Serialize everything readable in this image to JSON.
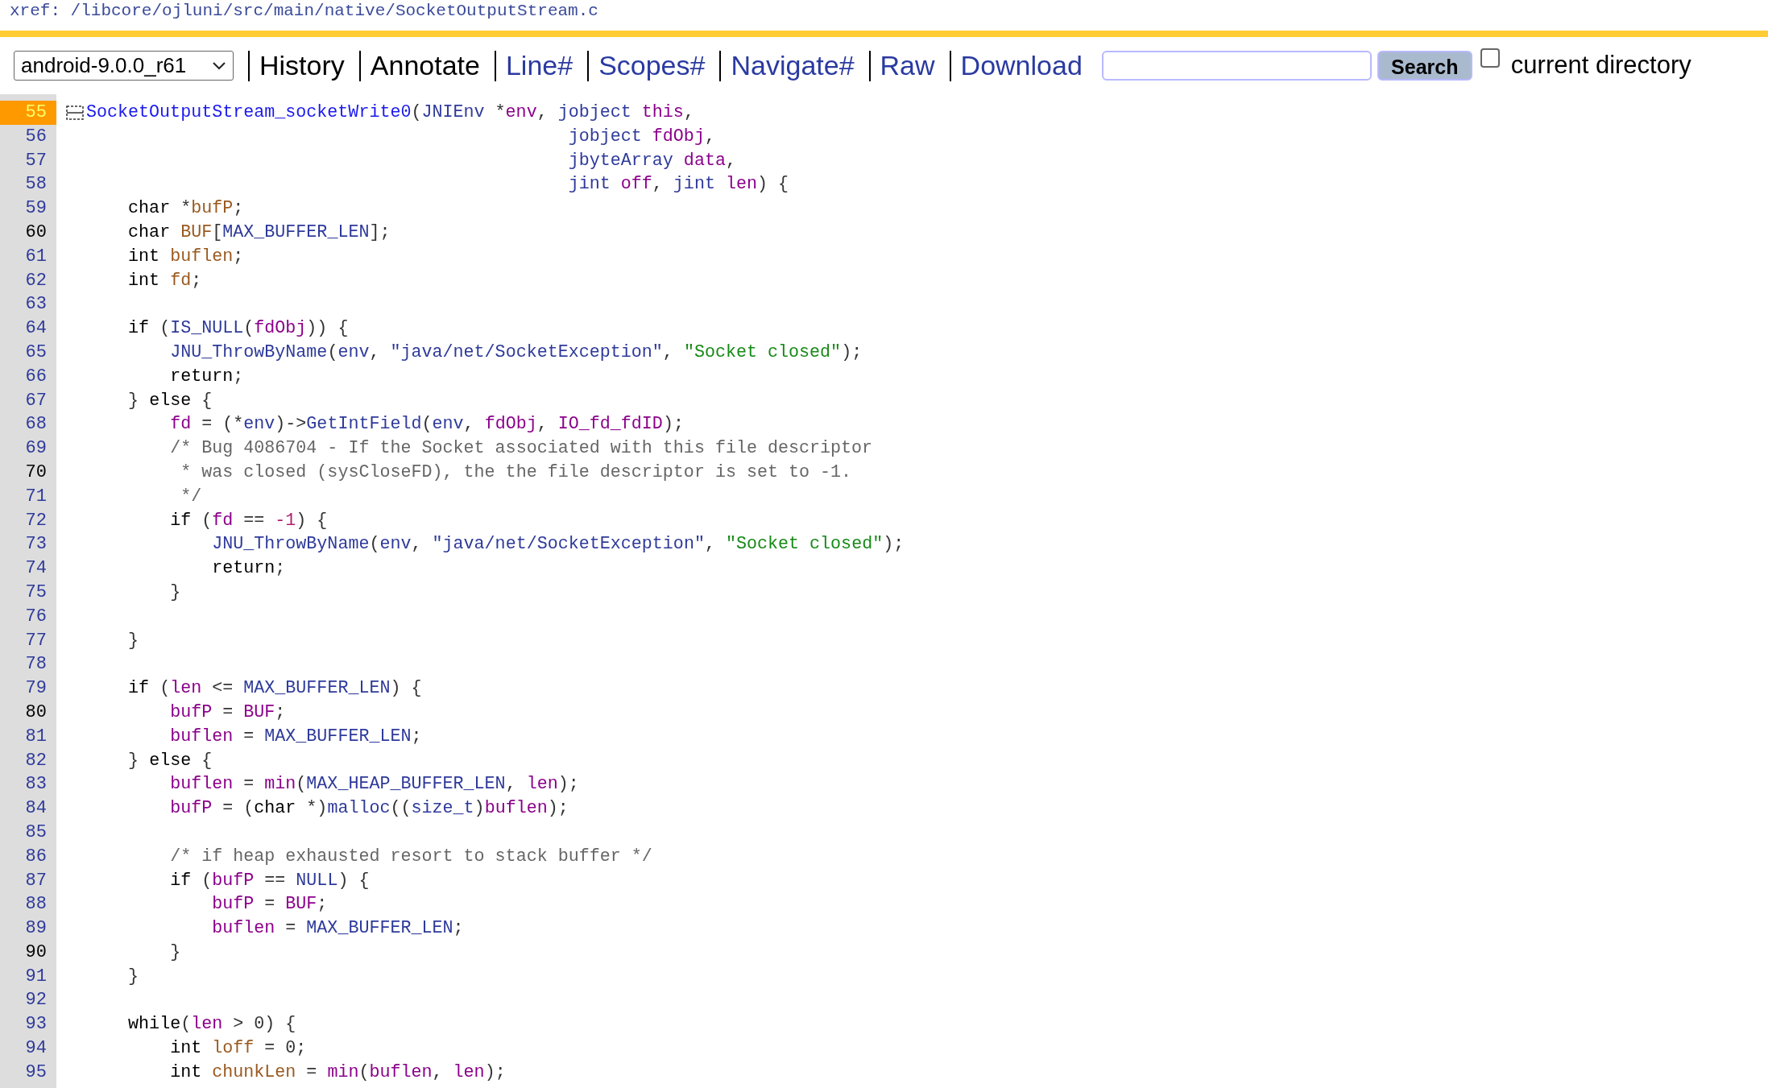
{
  "breadcrumb": "xref: /libcore/ojluni/src/main/native/SocketOutputStream.c",
  "toolbar": {
    "version_select": "android-9.0.0_r61",
    "links": [
      {
        "label": "History",
        "disabled": true
      },
      {
        "label": "Annotate",
        "disabled": true
      },
      {
        "label": "Line#",
        "disabled": false
      },
      {
        "label": "Scopes#",
        "disabled": false
      },
      {
        "label": "Navigate#",
        "disabled": false
      },
      {
        "label": "Raw",
        "disabled": false
      },
      {
        "label": "Download",
        "disabled": false
      }
    ],
    "search_button": "Search",
    "current_directory": {
      "label": "current directory",
      "checked": false
    }
  },
  "lines": [
    {
      "number": "55",
      "selected": true,
      "emphasis": false,
      "foldable": true,
      "tokens": [
        {
          "kind": "def",
          "text": "SocketOutputStream_socketWrite0"
        },
        {
          "kind": "pun",
          "text": "("
        },
        {
          "kind": "ref",
          "text": "JNIEnv"
        },
        {
          "kind": "pun",
          "text": " *"
        },
        {
          "kind": "var",
          "text": "env"
        },
        {
          "kind": "pun",
          "text": ", "
        },
        {
          "kind": "ref",
          "text": "jobject"
        },
        {
          "kind": "var",
          "text": " this"
        },
        {
          "kind": "pun",
          "text": ","
        }
      ]
    },
    {
      "number": "56",
      "selected": false,
      "emphasis": false,
      "foldable": false,
      "tokens": [
        {
          "kind": "ref",
          "text": "                                                jobject"
        },
        {
          "kind": "var",
          "text": " fdObj"
        },
        {
          "kind": "pun",
          "text": ","
        }
      ]
    },
    {
      "number": "57",
      "selected": false,
      "emphasis": false,
      "foldable": false,
      "tokens": [
        {
          "kind": "ref",
          "text": "                                                jbyteArray"
        },
        {
          "kind": "var",
          "text": " data"
        },
        {
          "kind": "pun",
          "text": ","
        }
      ]
    },
    {
      "number": "58",
      "selected": false,
      "emphasis": false,
      "foldable": false,
      "tokens": [
        {
          "kind": "ref",
          "text": "                                                jint"
        },
        {
          "kind": "var",
          "text": " off"
        },
        {
          "kind": "pun",
          "text": ", "
        },
        {
          "kind": "ref",
          "text": "jint"
        },
        {
          "kind": "var",
          "text": " len"
        },
        {
          "kind": "pun",
          "text": ") {"
        }
      ]
    },
    {
      "number": "59",
      "selected": false,
      "emphasis": false,
      "foldable": false,
      "tokens": [
        {
          "kind": "kw",
          "text": "      char"
        },
        {
          "kind": "pun",
          "text": " *"
        },
        {
          "kind": "loc",
          "text": "bufP"
        },
        {
          "kind": "pun",
          "text": ";"
        }
      ]
    },
    {
      "number": "60",
      "selected": false,
      "emphasis": true,
      "foldable": false,
      "tokens": [
        {
          "kind": "kw",
          "text": "      char"
        },
        {
          "kind": "loc",
          "text": " BUF"
        },
        {
          "kind": "pun",
          "text": "["
        },
        {
          "kind": "ref",
          "text": "MAX_BUFFER_LEN"
        },
        {
          "kind": "pun",
          "text": "];"
        }
      ]
    },
    {
      "number": "61",
      "selected": false,
      "emphasis": false,
      "foldable": false,
      "tokens": [
        {
          "kind": "kw",
          "text": "      int"
        },
        {
          "kind": "loc",
          "text": " buflen"
        },
        {
          "kind": "pun",
          "text": ";"
        }
      ]
    },
    {
      "number": "62",
      "selected": false,
      "emphasis": false,
      "foldable": false,
      "tokens": [
        {
          "kind": "kw",
          "text": "      int"
        },
        {
          "kind": "loc",
          "text": " fd"
        },
        {
          "kind": "pun",
          "text": ";"
        }
      ]
    },
    {
      "number": "63",
      "selected": false,
      "emphasis": false,
      "foldable": false
    },
    {
      "number": "64",
      "selected": false,
      "emphasis": false,
      "foldable": false,
      "tokens": [
        {
          "kind": "kw",
          "text": "      if"
        },
        {
          "kind": "pun",
          "text": " ("
        },
        {
          "kind": "ref",
          "text": "IS_NULL"
        },
        {
          "kind": "pun",
          "text": "("
        },
        {
          "kind": "var",
          "text": "fdObj"
        },
        {
          "kind": "pun",
          "text": ")) {"
        }
      ]
    },
    {
      "number": "65",
      "selected": false,
      "emphasis": false,
      "foldable": false,
      "tokens": [
        {
          "kind": "ref",
          "text": "          JNU_ThrowByName"
        },
        {
          "kind": "pun",
          "text": "("
        },
        {
          "kind": "ref",
          "text": "env"
        },
        {
          "kind": "pun",
          "text": ", "
        },
        {
          "kind": "ref",
          "text": "\"java/net/SocketException\""
        },
        {
          "kind": "pun",
          "text": ", "
        },
        {
          "kind": "str",
          "text": "\"Socket closed\""
        },
        {
          "kind": "pun",
          "text": ");"
        }
      ]
    },
    {
      "number": "66",
      "selected": false,
      "emphasis": false,
      "foldable": false,
      "tokens": [
        {
          "kind": "kw",
          "text": "          return"
        },
        {
          "kind": "pun",
          "text": ";"
        }
      ]
    },
    {
      "number": "67",
      "selected": false,
      "emphasis": false,
      "foldable": false,
      "tokens": [
        {
          "kind": "pun",
          "text": "      } "
        },
        {
          "kind": "kw",
          "text": "else"
        },
        {
          "kind": "pun",
          "text": " {"
        }
      ]
    },
    {
      "number": "68",
      "selected": false,
      "emphasis": false,
      "foldable": false,
      "tokens": [
        {
          "kind": "var",
          "text": "          fd"
        },
        {
          "kind": "pun",
          "text": " = (*"
        },
        {
          "kind": "ref",
          "text": "env"
        },
        {
          "kind": "pun",
          "text": ")->"
        },
        {
          "kind": "ref",
          "text": "GetIntField"
        },
        {
          "kind": "pun",
          "text": "("
        },
        {
          "kind": "ref",
          "text": "env"
        },
        {
          "kind": "pun",
          "text": ", "
        },
        {
          "kind": "var",
          "text": "fdObj"
        },
        {
          "kind": "pun",
          "text": ", "
        },
        {
          "kind": "var",
          "text": "IO_fd_fdID"
        },
        {
          "kind": "pun",
          "text": ");"
        }
      ]
    },
    {
      "number": "69",
      "selected": false,
      "emphasis": false,
      "foldable": false,
      "tokens": [
        {
          "kind": "com",
          "text": "          /* Bug 4086704 - If the Socket associated with this file descriptor"
        }
      ]
    },
    {
      "number": "70",
      "selected": false,
      "emphasis": true,
      "foldable": false,
      "tokens": [
        {
          "kind": "com",
          "text": "           * was closed (sysCloseFD), the the file descriptor is set to -1."
        }
      ]
    },
    {
      "number": "71",
      "selected": false,
      "emphasis": false,
      "foldable": false,
      "tokens": [
        {
          "kind": "com",
          "text": "           */"
        }
      ]
    },
    {
      "number": "72",
      "selected": false,
      "emphasis": false,
      "foldable": false,
      "tokens": [
        {
          "kind": "kw",
          "text": "          if"
        },
        {
          "kind": "pun",
          "text": " ("
        },
        {
          "kind": "var",
          "text": "fd"
        },
        {
          "kind": "pun",
          "text": " == "
        },
        {
          "kind": "num",
          "text": "-1"
        },
        {
          "kind": "pun",
          "text": ") {"
        }
      ]
    },
    {
      "number": "73",
      "selected": false,
      "emphasis": false,
      "foldable": false,
      "tokens": [
        {
          "kind": "ref",
          "text": "              JNU_ThrowByName"
        },
        {
          "kind": "pun",
          "text": "("
        },
        {
          "kind": "ref",
          "text": "env"
        },
        {
          "kind": "pun",
          "text": ", "
        },
        {
          "kind": "ref",
          "text": "\"java/net/SocketException\""
        },
        {
          "kind": "pun",
          "text": ", "
        },
        {
          "kind": "str",
          "text": "\"Socket closed\""
        },
        {
          "kind": "pun",
          "text": ");"
        }
      ]
    },
    {
      "number": "74",
      "selected": false,
      "emphasis": false,
      "foldable": false,
      "tokens": [
        {
          "kind": "kw",
          "text": "              return"
        },
        {
          "kind": "pun",
          "text": ";"
        }
      ]
    },
    {
      "number": "75",
      "selected": false,
      "emphasis": false,
      "foldable": false,
      "tokens": [
        {
          "kind": "pun",
          "text": "          }"
        }
      ]
    },
    {
      "number": "76",
      "selected": false,
      "emphasis": false,
      "foldable": false
    },
    {
      "number": "77",
      "selected": false,
      "emphasis": false,
      "foldable": false,
      "tokens": [
        {
          "kind": "pun",
          "text": "      }"
        }
      ]
    },
    {
      "number": "78",
      "selected": false,
      "emphasis": false,
      "foldable": false
    },
    {
      "number": "79",
      "selected": false,
      "emphasis": false,
      "foldable": false,
      "tokens": [
        {
          "kind": "kw",
          "text": "      if"
        },
        {
          "kind": "pun",
          "text": " ("
        },
        {
          "kind": "var",
          "text": "len"
        },
        {
          "kind": "pun",
          "text": " <= "
        },
        {
          "kind": "ref",
          "text": "MAX_BUFFER_LEN"
        },
        {
          "kind": "pun",
          "text": ") {"
        }
      ]
    },
    {
      "number": "80",
      "selected": false,
      "emphasis": true,
      "foldable": false,
      "tokens": [
        {
          "kind": "var",
          "text": "          bufP"
        },
        {
          "kind": "pun",
          "text": " = "
        },
        {
          "kind": "var",
          "text": "BUF"
        },
        {
          "kind": "pun",
          "text": ";"
        }
      ]
    },
    {
      "number": "81",
      "selected": false,
      "emphasis": false,
      "foldable": false,
      "tokens": [
        {
          "kind": "var",
          "text": "          buflen"
        },
        {
          "kind": "pun",
          "text": " = "
        },
        {
          "kind": "ref",
          "text": "MAX_BUFFER_LEN"
        },
        {
          "kind": "pun",
          "text": ";"
        }
      ]
    },
    {
      "number": "82",
      "selected": false,
      "emphasis": false,
      "foldable": false,
      "tokens": [
        {
          "kind": "pun",
          "text": "      } "
        },
        {
          "kind": "kw",
          "text": "else"
        },
        {
          "kind": "pun",
          "text": " {"
        }
      ]
    },
    {
      "number": "83",
      "selected": false,
      "emphasis": false,
      "foldable": false,
      "tokens": [
        {
          "kind": "var",
          "text": "          buflen"
        },
        {
          "kind": "pun",
          "text": " = "
        },
        {
          "kind": "var",
          "text": "min"
        },
        {
          "kind": "pun",
          "text": "("
        },
        {
          "kind": "ref",
          "text": "MAX_HEAP_BUFFER_LEN"
        },
        {
          "kind": "pun",
          "text": ", "
        },
        {
          "kind": "var",
          "text": "len"
        },
        {
          "kind": "pun",
          "text": ");"
        }
      ]
    },
    {
      "number": "84",
      "selected": false,
      "emphasis": false,
      "foldable": false,
      "tokens": [
        {
          "kind": "var",
          "text": "          bufP"
        },
        {
          "kind": "pun",
          "text": " = ("
        },
        {
          "kind": "kw",
          "text": "char"
        },
        {
          "kind": "pun",
          "text": " *)"
        },
        {
          "kind": "ref",
          "text": "malloc"
        },
        {
          "kind": "pun",
          "text": "(("
        },
        {
          "kind": "ref",
          "text": "size_t"
        },
        {
          "kind": "pun",
          "text": ")"
        },
        {
          "kind": "var",
          "text": "buflen"
        },
        {
          "kind": "pun",
          "text": ");"
        }
      ]
    },
    {
      "number": "85",
      "selected": false,
      "emphasis": false,
      "foldable": false
    },
    {
      "number": "86",
      "selected": false,
      "emphasis": false,
      "foldable": false,
      "tokens": [
        {
          "kind": "com",
          "text": "          /* if heap exhausted resort to stack buffer */"
        }
      ]
    },
    {
      "number": "87",
      "selected": false,
      "emphasis": false,
      "foldable": false,
      "tokens": [
        {
          "kind": "kw",
          "text": "          if"
        },
        {
          "kind": "pun",
          "text": " ("
        },
        {
          "kind": "var",
          "text": "bufP"
        },
        {
          "kind": "pun",
          "text": " == "
        },
        {
          "kind": "ref",
          "text": "NULL"
        },
        {
          "kind": "pun",
          "text": ") {"
        }
      ]
    },
    {
      "number": "88",
      "selected": false,
      "emphasis": false,
      "foldable": false,
      "tokens": [
        {
          "kind": "var",
          "text": "              bufP"
        },
        {
          "kind": "pun",
          "text": " = "
        },
        {
          "kind": "var",
          "text": "BUF"
        },
        {
          "kind": "pun",
          "text": ";"
        }
      ]
    },
    {
      "number": "89",
      "selected": false,
      "emphasis": false,
      "foldable": false,
      "tokens": [
        {
          "kind": "var",
          "text": "              buflen"
        },
        {
          "kind": "pun",
          "text": " = "
        },
        {
          "kind": "ref",
          "text": "MAX_BUFFER_LEN"
        },
        {
          "kind": "pun",
          "text": ";"
        }
      ]
    },
    {
      "number": "90",
      "selected": false,
      "emphasis": true,
      "foldable": false,
      "tokens": [
        {
          "kind": "pun",
          "text": "          }"
        }
      ]
    },
    {
      "number": "91",
      "selected": false,
      "emphasis": false,
      "foldable": false,
      "tokens": [
        {
          "kind": "pun",
          "text": "      }"
        }
      ]
    },
    {
      "number": "92",
      "selected": false,
      "emphasis": false,
      "foldable": false
    },
    {
      "number": "93",
      "selected": false,
      "emphasis": false,
      "foldable": false,
      "tokens": [
        {
          "kind": "kw",
          "text": "      while"
        },
        {
          "kind": "pun",
          "text": "("
        },
        {
          "kind": "var",
          "text": "len"
        },
        {
          "kind": "pun",
          "text": " > 0) {"
        }
      ]
    },
    {
      "number": "94",
      "selected": false,
      "emphasis": false,
      "foldable": false,
      "tokens": [
        {
          "kind": "kw",
          "text": "          int"
        },
        {
          "kind": "loc",
          "text": " loff"
        },
        {
          "kind": "pun",
          "text": " = 0;"
        }
      ]
    },
    {
      "number": "95",
      "selected": false,
      "emphasis": false,
      "foldable": false,
      "tokens": [
        {
          "kind": "kw",
          "text": "          int"
        },
        {
          "kind": "loc",
          "text": " chunkLen"
        },
        {
          "kind": "pun",
          "text": " = "
        },
        {
          "kind": "var",
          "text": "min"
        },
        {
          "kind": "pun",
          "text": "("
        },
        {
          "kind": "var",
          "text": "buflen"
        },
        {
          "kind": "pun",
          "text": ", "
        },
        {
          "kind": "var",
          "text": "len"
        },
        {
          "kind": "pun",
          "text": ");"
        }
      ]
    }
  ]
}
